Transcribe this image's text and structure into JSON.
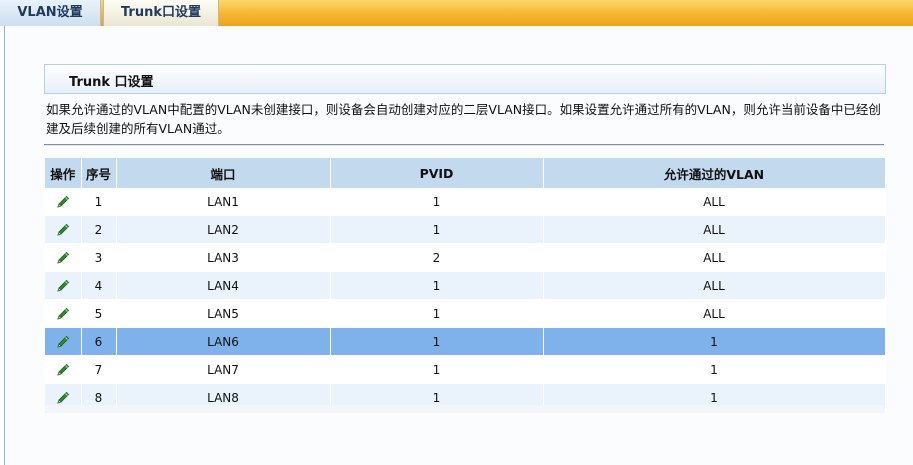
{
  "tabs": [
    {
      "label": "VLAN设置"
    },
    {
      "label": "Trunk口设置"
    }
  ],
  "section": {
    "title": "Trunk 口设置",
    "description": "如果允许通过的VLAN中配置的VLAN未创建接口，则设备会自动创建对应的二层VLAN接口。如果设置允许通过所有的VLAN，则允许当前设备中已经创建及后续创建的所有VLAN通过。"
  },
  "table": {
    "headers": [
      "操作",
      "序号",
      "端口",
      "PVID",
      "允许通过的VLAN"
    ],
    "rows": [
      {
        "index": "1",
        "port": "LAN1",
        "pvid": "1",
        "allowed": "ALL"
      },
      {
        "index": "2",
        "port": "LAN2",
        "pvid": "1",
        "allowed": "ALL"
      },
      {
        "index": "3",
        "port": "LAN3",
        "pvid": "2",
        "allowed": "ALL"
      },
      {
        "index": "4",
        "port": "LAN4",
        "pvid": "1",
        "allowed": "ALL"
      },
      {
        "index": "5",
        "port": "LAN5",
        "pvid": "1",
        "allowed": "ALL"
      },
      {
        "index": "6",
        "port": "LAN6",
        "pvid": "1",
        "allowed": "1"
      },
      {
        "index": "7",
        "port": "LAN7",
        "pvid": "1",
        "allowed": "1"
      },
      {
        "index": "8",
        "port": "LAN8",
        "pvid": "1",
        "allowed": "1"
      }
    ],
    "selected_index": "6",
    "edit_icon": "pencil-icon"
  },
  "colors": {
    "tabbar": "#f6b52f",
    "header_bg": "#c3d9ee",
    "row_alt": "#eaf3fc",
    "row_selected": "#7fb1ea",
    "edit_icon": "#2e8b2e"
  }
}
